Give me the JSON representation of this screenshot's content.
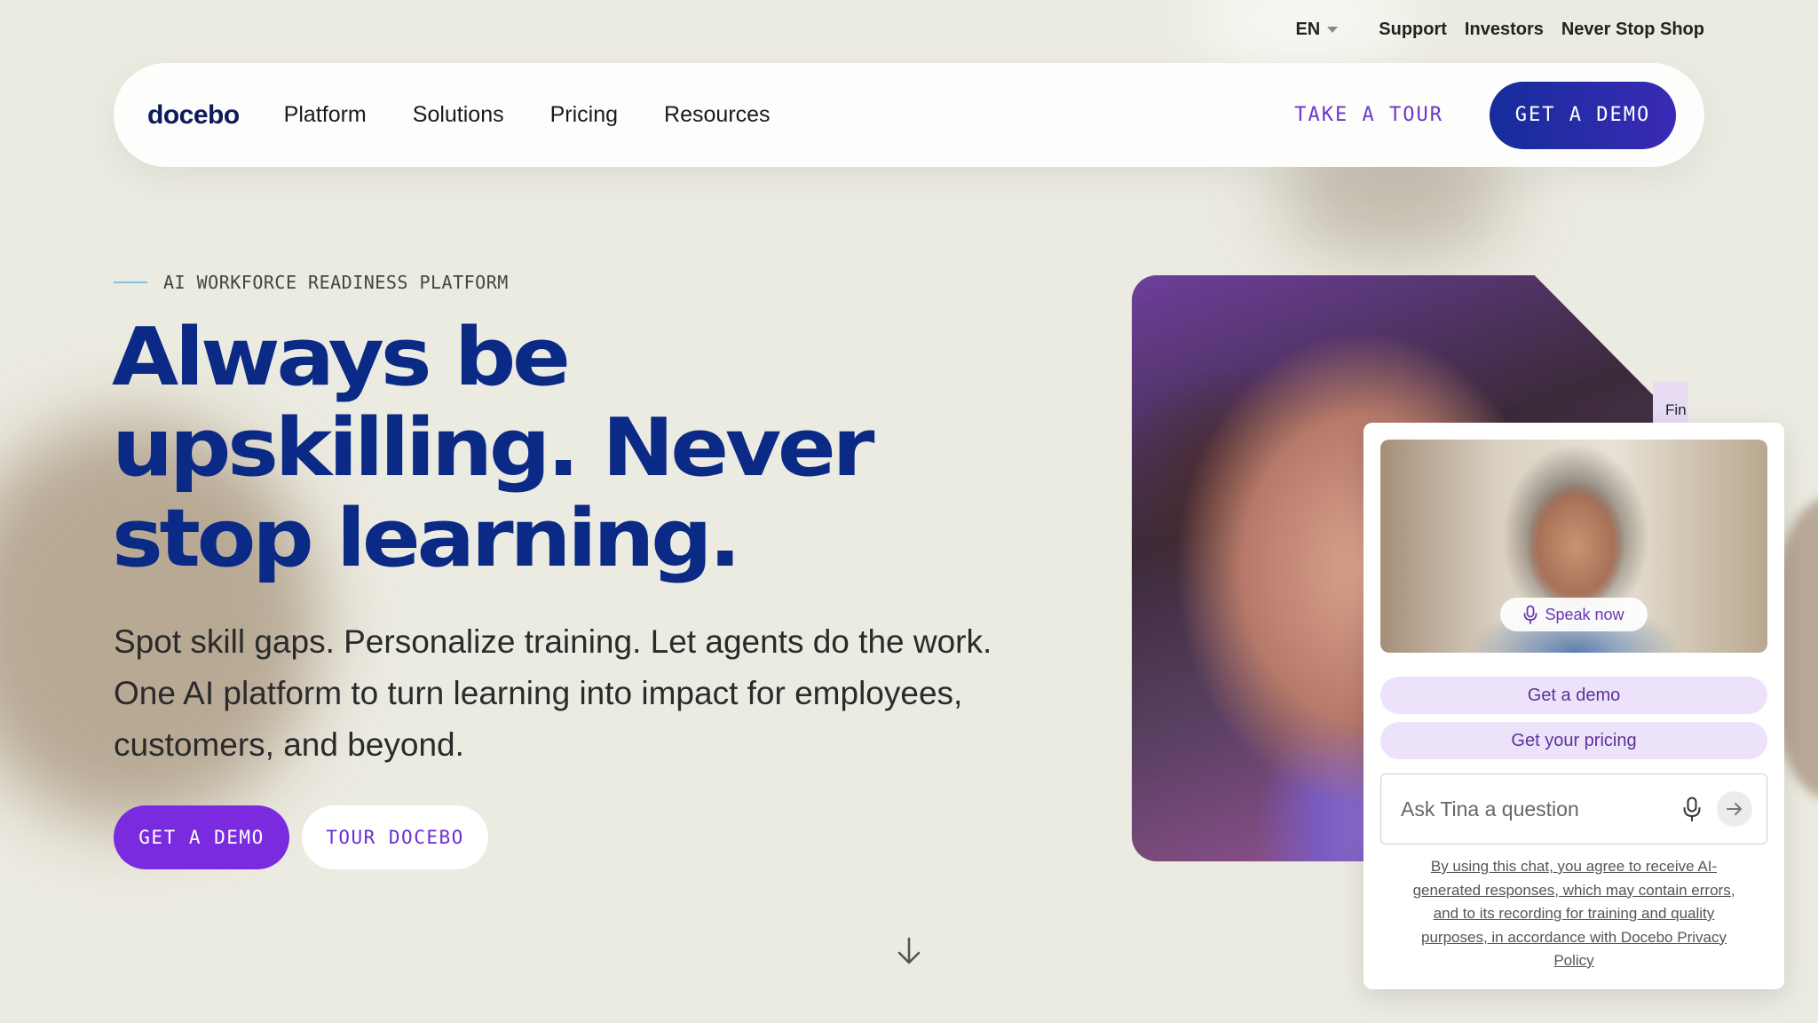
{
  "utility_nav": {
    "language": "EN",
    "links": [
      "Support",
      "Investors",
      "Never Stop Shop"
    ]
  },
  "nav": {
    "logo": "docebo",
    "links": [
      "Platform",
      "Solutions",
      "Pricing",
      "Resources"
    ],
    "take_tour": "TAKE A TOUR",
    "get_demo": "GET A DEMO"
  },
  "hero": {
    "eyebrow": "AI WORKFORCE READINESS PLATFORM",
    "headline_lines": [
      "Always be",
      "upskilling. Never",
      "stop learning."
    ],
    "subtext_lines": [
      "Spot skill gaps. Personalize training. Let agents do the work.",
      "One AI platform to turn learning into impact for employees,",
      "customers, and beyond."
    ],
    "primary_cta": "GET A DEMO",
    "secondary_cta": "TOUR DOCEBO"
  },
  "hero_image": {
    "partial_label": "Fin"
  },
  "chat": {
    "speak_now": "Speak now",
    "quick_actions": [
      "Get a demo",
      "Get your pricing"
    ],
    "input_placeholder": "Ask Tina a question",
    "disclaimer_lines": [
      "By using this chat, you agree to receive AI-",
      "generated responses, which may contain errors,",
      "and to its recording for training and quality",
      "purposes, in accordance with Docebo Privacy",
      "Policy"
    ]
  },
  "colors": {
    "background": "#ecebe1",
    "headline": "#0b2a86",
    "primary_purple": "#7a2be0",
    "nav_demo_gradient_start": "#152d9a",
    "chat_action_bg": "#ece3fb"
  }
}
